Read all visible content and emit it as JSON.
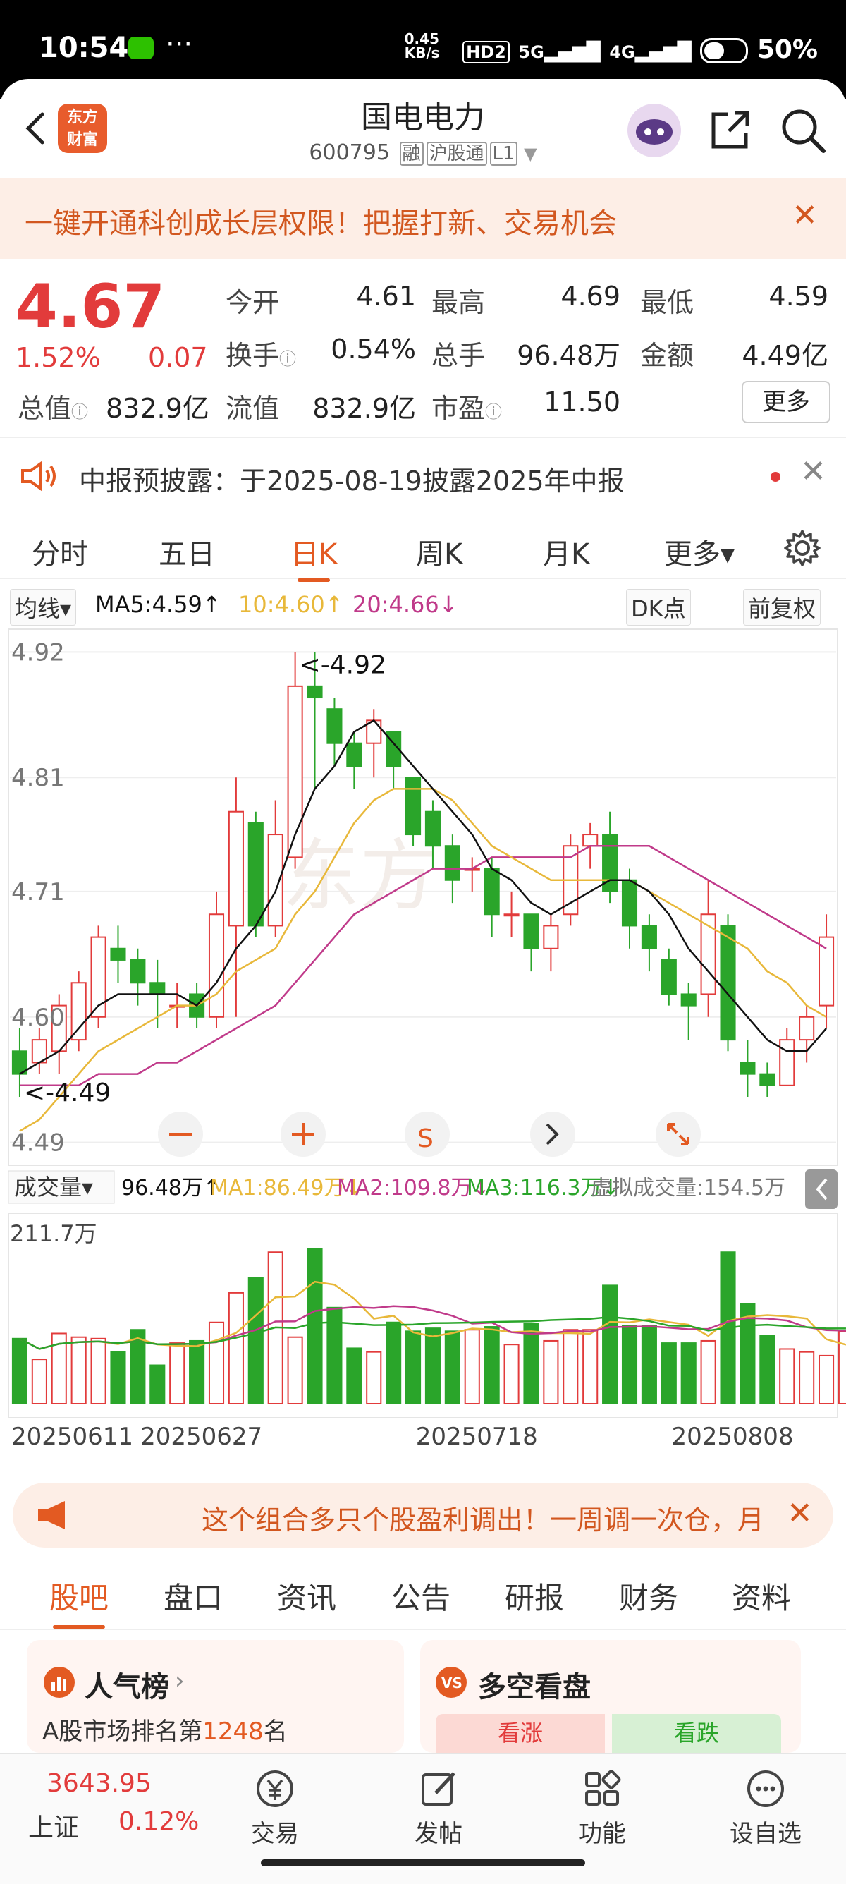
{
  "status_bar": {
    "time": "10:54",
    "dots": "···",
    "net_speed": "0.45 KB/s",
    "hd": "HD2",
    "signal1": "5G",
    "signal2": "4G",
    "battery": "50%"
  },
  "header": {
    "logo_line1": "东方",
    "logo_line2": "财富",
    "title": "国电电力",
    "code": "600795",
    "tags": [
      "融",
      "沪股通",
      "L1"
    ]
  },
  "promo": {
    "text": "一键开通科创成长层权限！把握打新、交易机会",
    "close": "✕"
  },
  "quote": {
    "price": "4.67",
    "change_pct": "1.52%",
    "change": "0.07",
    "rows": [
      [
        {
          "k": "今开",
          "v": "4.61",
          "c": "red"
        },
        {
          "k": "最高",
          "v": "4.69",
          "c": "red"
        },
        {
          "k": "最低",
          "v": "4.59",
          "c": "green"
        }
      ],
      [
        {
          "k": "换手",
          "v": "0.54%",
          "c": "dark"
        },
        {
          "k": "总手",
          "v": "96.48万",
          "c": "dark"
        },
        {
          "k": "金额",
          "v": "4.49亿",
          "c": "dark"
        }
      ],
      [
        {
          "k": "流值",
          "v": "832.9亿",
          "c": "dark"
        },
        {
          "k": "市盈",
          "v": "11.50",
          "c": "dark"
        }
      ]
    ],
    "market_cap_label": "总值",
    "market_cap": "832.9亿",
    "more": "更多"
  },
  "notice": {
    "text": "中报预披露：于2025-08-19披露2025年中报",
    "close": "✕"
  },
  "period_tabs": [
    "分时",
    "五日",
    "日K",
    "周K",
    "月K",
    "更多▾"
  ],
  "active_period": "日K",
  "ma_legend": {
    "type": "均线▾",
    "ma5": "MA5:4.59↑",
    "ma10": "10:4.60↑",
    "ma20": "20:4.66↓",
    "dk": "DK点",
    "adjust": "前复权"
  },
  "chart_labels": {
    "high_mark": "<-4.92",
    "low_mark": "<-4.49",
    "axis": [
      "4.92",
      "4.81",
      "4.71",
      "4.60",
      "4.49"
    ]
  },
  "vol_legend": {
    "type": "成交量▾",
    "vol": "96.48万↑",
    "ma1": "MA1:86.49万↓",
    "ma2": "MA2:109.8万↓",
    "ma3": "MA3:116.3万↓",
    "virtual": "虚拟成交量:154.5万",
    "max": "211.7万"
  },
  "dates": [
    "20250611",
    "20250627",
    "20250718",
    "20250808"
  ],
  "colors": {
    "up": "#e23b3b",
    "down": "#2aa52a",
    "ma5": "#111111",
    "ma10": "#e8b83a",
    "ma20": "#c03a8a",
    "accent": "#e35a22"
  },
  "chart_data": {
    "type": "candlestick",
    "ylim": [
      4.47,
      4.94
    ],
    "candles": [
      {
        "o": 4.57,
        "c": 4.55,
        "h": 4.59,
        "l": 4.53
      },
      {
        "o": 4.56,
        "c": 4.58,
        "h": 4.59,
        "l": 4.55
      },
      {
        "o": 4.57,
        "c": 4.61,
        "h": 4.62,
        "l": 4.55
      },
      {
        "o": 4.58,
        "c": 4.63,
        "h": 4.64,
        "l": 4.57
      },
      {
        "o": 4.6,
        "c": 4.67,
        "h": 4.68,
        "l": 4.59
      },
      {
        "o": 4.66,
        "c": 4.65,
        "h": 4.68,
        "l": 4.63
      },
      {
        "o": 4.65,
        "c": 4.63,
        "h": 4.66,
        "l": 4.61
      },
      {
        "o": 4.63,
        "c": 4.62,
        "h": 4.65,
        "l": 4.59
      },
      {
        "o": 4.61,
        "c": 4.61,
        "h": 4.63,
        "l": 4.59
      },
      {
        "o": 4.62,
        "c": 4.6,
        "h": 4.63,
        "l": 4.59
      },
      {
        "o": 4.6,
        "c": 4.69,
        "h": 4.71,
        "l": 4.59
      },
      {
        "o": 4.68,
        "c": 4.78,
        "h": 4.81,
        "l": 4.6
      },
      {
        "o": 4.77,
        "c": 4.68,
        "h": 4.78,
        "l": 4.67
      },
      {
        "o": 4.68,
        "c": 4.76,
        "h": 4.79,
        "l": 4.67
      },
      {
        "o": 4.74,
        "c": 4.89,
        "h": 4.92,
        "l": 4.73
      },
      {
        "o": 4.89,
        "c": 4.88,
        "h": 4.92,
        "l": 4.8
      },
      {
        "o": 4.87,
        "c": 4.84,
        "h": 4.88,
        "l": 4.82
      },
      {
        "o": 4.84,
        "c": 4.82,
        "h": 4.85,
        "l": 4.8
      },
      {
        "o": 4.84,
        "c": 4.86,
        "h": 4.87,
        "l": 4.81
      },
      {
        "o": 4.85,
        "c": 4.82,
        "h": 4.85,
        "l": 4.8
      },
      {
        "o": 4.81,
        "c": 4.76,
        "h": 4.81,
        "l": 4.75
      },
      {
        "o": 4.78,
        "c": 4.75,
        "h": 4.79,
        "l": 4.73
      },
      {
        "o": 4.75,
        "c": 4.72,
        "h": 4.76,
        "l": 4.7
      },
      {
        "o": 4.73,
        "c": 4.73,
        "h": 4.74,
        "l": 4.71
      },
      {
        "o": 4.73,
        "c": 4.69,
        "h": 4.74,
        "l": 4.67
      },
      {
        "o": 4.69,
        "c": 4.69,
        "h": 4.71,
        "l": 4.67
      },
      {
        "o": 4.69,
        "c": 4.66,
        "h": 4.69,
        "l": 4.64
      },
      {
        "o": 4.66,
        "c": 4.68,
        "h": 4.69,
        "l": 4.64
      },
      {
        "o": 4.69,
        "c": 4.75,
        "h": 4.76,
        "l": 4.68
      },
      {
        "o": 4.75,
        "c": 4.76,
        "h": 4.77,
        "l": 4.73
      },
      {
        "o": 4.76,
        "c": 4.71,
        "h": 4.78,
        "l": 4.7
      },
      {
        "o": 4.72,
        "c": 4.68,
        "h": 4.73,
        "l": 4.66
      },
      {
        "o": 4.68,
        "c": 4.66,
        "h": 4.69,
        "l": 4.64
      },
      {
        "o": 4.65,
        "c": 4.62,
        "h": 4.66,
        "l": 4.61
      },
      {
        "o": 4.62,
        "c": 4.61,
        "h": 4.63,
        "l": 4.58
      },
      {
        "o": 4.62,
        "c": 4.69,
        "h": 4.72,
        "l": 4.6
      },
      {
        "o": 4.68,
        "c": 4.58,
        "h": 4.69,
        "l": 4.57
      },
      {
        "o": 4.56,
        "c": 4.55,
        "h": 4.58,
        "l": 4.53
      },
      {
        "o": 4.55,
        "c": 4.54,
        "h": 4.56,
        "l": 4.53
      },
      {
        "o": 4.54,
        "c": 4.58,
        "h": 4.59,
        "l": 4.54
      },
      {
        "o": 4.58,
        "c": 4.6,
        "h": 4.61,
        "l": 4.56
      },
      {
        "o": 4.61,
        "c": 4.67,
        "h": 4.69,
        "l": 4.59
      }
    ],
    "ma5": [
      4.55,
      4.56,
      4.57,
      4.59,
      4.61,
      4.62,
      4.62,
      4.62,
      4.62,
      4.61,
      4.63,
      4.66,
      4.68,
      4.71,
      4.76,
      4.8,
      4.82,
      4.85,
      4.86,
      4.84,
      4.82,
      4.8,
      4.78,
      4.76,
      4.73,
      4.72,
      4.7,
      4.69,
      4.7,
      4.71,
      4.72,
      4.72,
      4.71,
      4.69,
      4.66,
      4.64,
      4.62,
      4.6,
      4.58,
      4.57,
      4.57,
      4.59
    ],
    "ma10": [
      4.5,
      4.51,
      4.53,
      4.55,
      4.57,
      4.58,
      4.59,
      4.6,
      4.61,
      4.61,
      4.62,
      4.64,
      4.65,
      4.66,
      4.69,
      4.71,
      4.74,
      4.77,
      4.79,
      4.8,
      4.8,
      4.8,
      4.79,
      4.77,
      4.75,
      4.74,
      4.73,
      4.72,
      4.72,
      4.72,
      4.72,
      4.72,
      4.71,
      4.7,
      4.69,
      4.68,
      4.67,
      4.66,
      4.64,
      4.63,
      4.61,
      4.6
    ],
    "ma20": [
      4.54,
      4.54,
      4.54,
      4.54,
      4.55,
      4.55,
      4.55,
      4.56,
      4.56,
      4.57,
      4.58,
      4.59,
      4.6,
      4.61,
      4.63,
      4.65,
      4.67,
      4.69,
      4.7,
      4.71,
      4.72,
      4.73,
      4.73,
      4.73,
      4.74,
      4.74,
      4.74,
      4.74,
      4.74,
      4.75,
      4.75,
      4.75,
      4.75,
      4.74,
      4.73,
      4.72,
      4.71,
      4.7,
      4.69,
      4.68,
      4.67,
      4.66
    ],
    "volume": [
      88,
      60,
      95,
      90,
      88,
      70,
      100,
      52,
      82,
      85,
      110,
      150,
      170,
      205,
      90,
      210,
      130,
      75,
      70,
      110,
      98,
      102,
      98,
      100,
      104,
      80,
      108,
      85,
      100,
      100,
      160,
      105,
      105,
      82,
      82,
      85,
      205,
      135,
      92,
      74,
      70,
      65,
      98
    ]
  },
  "banner": {
    "text": "这个组合多只个股盈利调出！一周调一次仓，月",
    "close": "✕"
  },
  "content_tabs": [
    "股吧",
    "盘口",
    "资讯",
    "公告",
    "研报",
    "财务",
    "资料"
  ],
  "cards": {
    "left_title": "人气榜",
    "left_sub_prefix": "A股市场排名第",
    "left_rank": "1248",
    "left_sub_suffix": "名",
    "right_title": "多空看盘",
    "bull": "看涨",
    "bear": "看跌"
  },
  "bottom_bar": {
    "index_value": "3643.95",
    "index_name": "上证",
    "index_change": "0.12%",
    "items": [
      "交易",
      "发帖",
      "功能",
      "设自选"
    ]
  }
}
